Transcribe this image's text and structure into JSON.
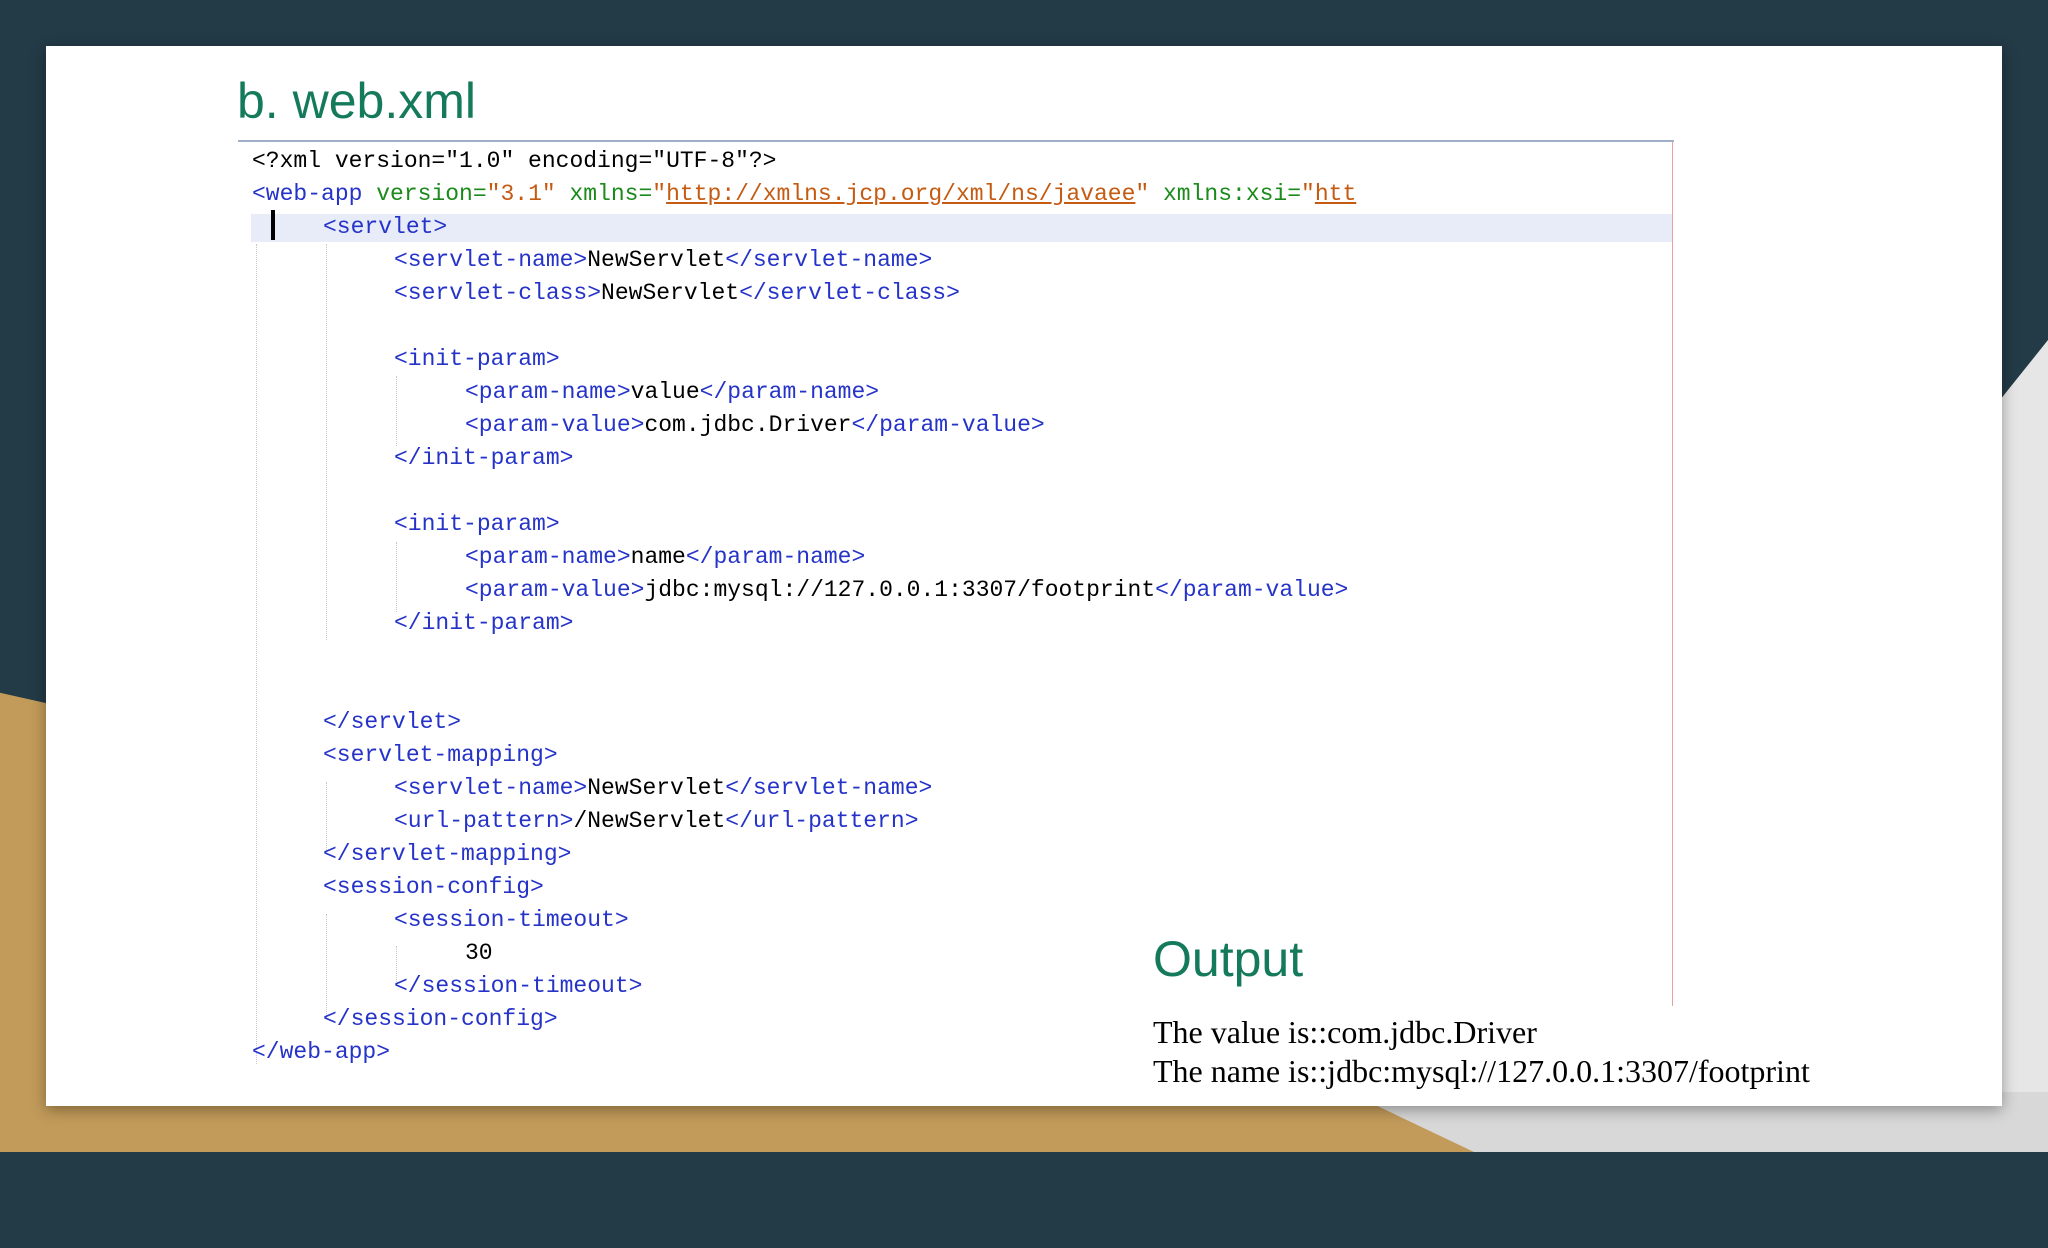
{
  "title": "b. web.xml",
  "code_lines": {
    "l1": "<?xml version=\"1.0\" encoding=\"UTF-8\"?>",
    "l2a": "<web-app",
    "l2b": " version=",
    "l2c": "\"3.1\"",
    "l2d": " xmlns=",
    "l2e": "\"",
    "l2f": "http://xmlns.jcp.org/xml/ns/javaee",
    "l2g": "\"",
    "l2h": " xmlns:xsi=",
    "l2i": "\"",
    "l2j": "htt",
    "l3": "<servlet>",
    "l4a": "<servlet-name>",
    "l4b": "NewServlet",
    "l4c": "</servlet-name>",
    "l5a": "<servlet-class>",
    "l5b": "NewServlet",
    "l5c": "</servlet-class>",
    "l7": "<init-param>",
    "l8a": "<param-name>",
    "l8b": "value",
    "l8c": "</param-name>",
    "l9a": "<param-value>",
    "l9b": "com.jdbc.Driver",
    "l9c": "</param-value>",
    "l10": "</init-param>",
    "l12": "<init-param>",
    "l13a": "<param-name>",
    "l13b": "name",
    "l13c": "</param-name>",
    "l14a": "<param-value>",
    "l14b": "jdbc:mysql://127.0.0.1:3307/footprint",
    "l14c": "</param-value>",
    "l15": "</init-param>",
    "l18": "</servlet>",
    "l19": "<servlet-mapping>",
    "l20a": "<servlet-name>",
    "l20b": "NewServlet",
    "l20c": "</servlet-name>",
    "l21a": "<url-pattern>",
    "l21b": "/NewServlet",
    "l21c": "</url-pattern>",
    "l22": "</servlet-mapping>",
    "l23": "<session-config>",
    "l24": "<session-timeout>",
    "l25": "30",
    "l26": "</session-timeout>",
    "l27": "</session-config>",
    "l28": "</web-app>"
  },
  "output": {
    "title": "Output",
    "line1": "The value is::com.jdbc.Driver",
    "line2": "The name is::jdbc:mysql://127.0.0.1:3307/footprint"
  },
  "colors": {
    "title": "#157a5b",
    "tag": "#2533c8",
    "attribute": "#1a8a1a",
    "value": "#c55a11"
  }
}
